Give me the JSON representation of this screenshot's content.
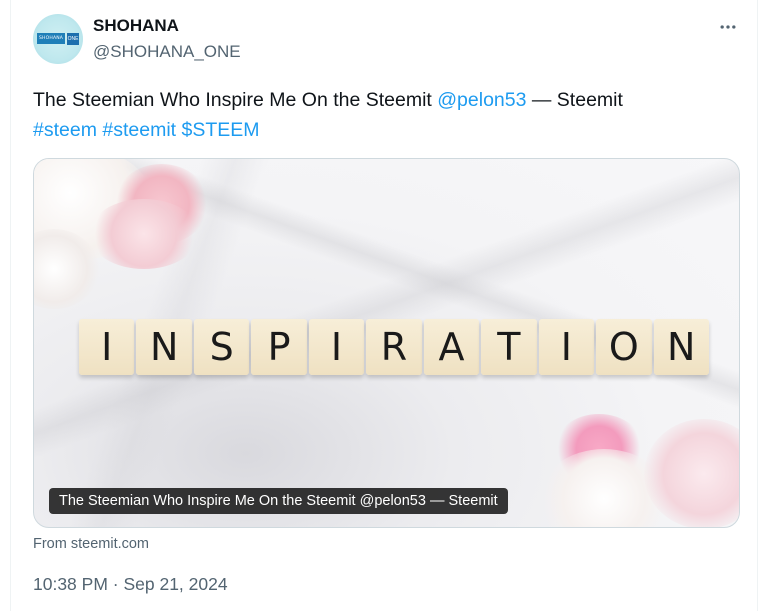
{
  "user": {
    "name": "SHOHANA",
    "handle": "@SHOHANA_ONE",
    "avatar_text": "SHOHANA",
    "avatar_badge": "ONE"
  },
  "more_icon": "ellipsis-icon",
  "tweet": {
    "text_prefix": "The Steemian Who Inspire Me On the Steemit ",
    "mention": "@pelon53",
    "text_suffix": " — Steemit",
    "hashtag1": "#steem",
    "hashtag2": "#steemit",
    "cashtag": "$STEEM"
  },
  "media": {
    "tiles": [
      "I",
      "N",
      "S",
      "P",
      "I",
      "R",
      "A",
      "T",
      "I",
      "O",
      "N"
    ],
    "caption": "The Steemian Who Inspire Me On the Steemit @pelon53 — Steemit"
  },
  "source": "From steemit.com",
  "timestamp": "10:38 PM · Sep 21, 2024",
  "colors": {
    "link": "#1d9bf0",
    "secondary_text": "#536471",
    "primary_text": "#0f1419"
  }
}
